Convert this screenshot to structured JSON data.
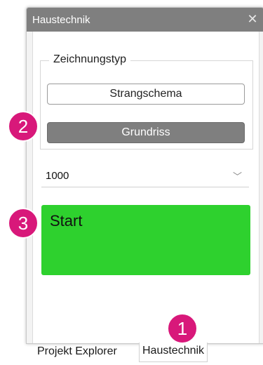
{
  "panel": {
    "title": "Haustechnik",
    "close_icon": "close-icon"
  },
  "group": {
    "label": "Zeichnungstyp",
    "buttons": [
      {
        "label": "Strangschema"
      },
      {
        "label": "Grundriss"
      }
    ]
  },
  "select": {
    "value": "1000",
    "chevron_icon": "chevron-down-icon"
  },
  "start_button": {
    "label": "Start",
    "color": "#2ed12e"
  },
  "tabs": [
    {
      "label": "Projekt Explorer"
    },
    {
      "label": "Haustechnik"
    }
  ],
  "badges": [
    "1",
    "2",
    "3"
  ],
  "colors": {
    "titlebar": "#7f7f7f",
    "badge": "#d8187a",
    "selected_button": "#7f7f7f"
  }
}
